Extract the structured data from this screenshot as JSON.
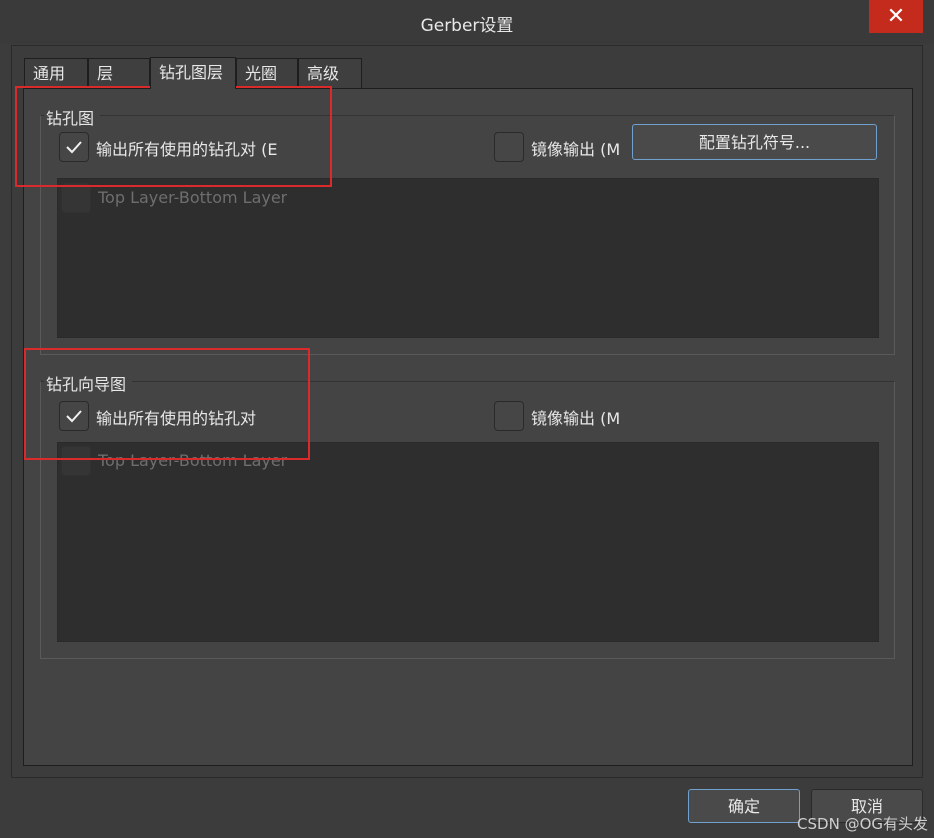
{
  "window": {
    "title": "Gerber设置",
    "close_glyph": "✕"
  },
  "tabs": [
    {
      "label": "通用"
    },
    {
      "label": "层"
    },
    {
      "label": "钻孔图层",
      "active": true
    },
    {
      "label": "光圈"
    },
    {
      "label": "高级"
    }
  ],
  "drill_drawing": {
    "title": "钻孔图",
    "output_all_pairs": {
      "label": "输出所有使用的钻孔对 (E",
      "checked": true
    },
    "mirror_output": {
      "label": "镜像输出 (M",
      "checked": false
    },
    "config_button": "配置钻孔符号...",
    "layer_pairs": [
      {
        "label": "Top Layer-Bottom Layer",
        "enabled": false
      }
    ]
  },
  "drill_guide": {
    "title": "钻孔向导图",
    "output_all_pairs": {
      "label": "输出所有使用的钻孔对",
      "checked": true
    },
    "mirror_output": {
      "label": "镜像输出 (M",
      "checked": false
    },
    "layer_pairs": [
      {
        "label": "Top Layer-Bottom Layer",
        "enabled": false
      }
    ]
  },
  "footer": {
    "ok": "确定",
    "cancel": "取消"
  },
  "watermark": "CSDN @OG有头发",
  "colors": {
    "highlight": "#d92b2b",
    "focus": "#6fa0cf",
    "close": "#c42b1c"
  }
}
